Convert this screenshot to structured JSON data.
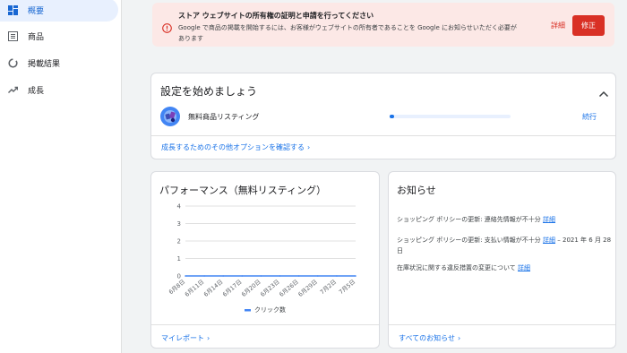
{
  "sidebar": {
    "items": [
      {
        "label": "概要",
        "icon": "dashboard-icon",
        "active": true
      },
      {
        "label": "商品",
        "icon": "products-icon",
        "active": false
      },
      {
        "label": "掲載結果",
        "icon": "performance-icon",
        "active": false
      },
      {
        "label": "成長",
        "icon": "growth-icon",
        "active": false
      }
    ]
  },
  "alert": {
    "title": "ストア ウェブサイトの所有権の証明と申請を行ってください",
    "body": "Google で商品の掲載を開始するには、お客様がウェブサイトの所有者であることを Google にお知らせいただく必要があります",
    "details_label": "詳細",
    "fix_label": "修正",
    "color": "#d93025"
  },
  "setup": {
    "title": "設定を始めましょう",
    "product_label": "無料商品リスティング",
    "progress": 0.04,
    "continue_label": "続行",
    "more_link": "成長するためのその他オプションを確認する"
  },
  "performance": {
    "title": "パフォーマンス（無料リスティング）",
    "footer_link": "マイレポート"
  },
  "chart_data": {
    "type": "line",
    "x": [
      "6月8日",
      "6月11日",
      "6月14日",
      "6月17日",
      "6月20日",
      "6月23日",
      "6月26日",
      "6月29日",
      "7月2日",
      "7月5日"
    ],
    "series": [
      {
        "name": "クリック数",
        "values": [
          0,
          0,
          0,
          0,
          0,
          0,
          0,
          0,
          0,
          0
        ]
      }
    ],
    "yticks": [
      "4",
      "3",
      "2",
      "1",
      "0"
    ],
    "ylim": [
      0,
      4
    ],
    "grid": true,
    "legend": "bottom",
    "color": "#4285f4"
  },
  "news": {
    "title": "お知らせ",
    "items": [
      {
        "text": "ショッピング ポリシーの更新: 連絡先情報が不十分",
        "link": "詳細",
        "suffix": ""
      },
      {
        "text": "ショッピング ポリシーの更新: 支払い情報が不十分",
        "link": "詳細",
        "suffix": " – 2021 年 6 月 28 日"
      },
      {
        "text": "在庫状況に関する違反措置の変更について",
        "link": "詳細",
        "suffix": ""
      }
    ],
    "footer_link": "すべてのお知らせ"
  }
}
